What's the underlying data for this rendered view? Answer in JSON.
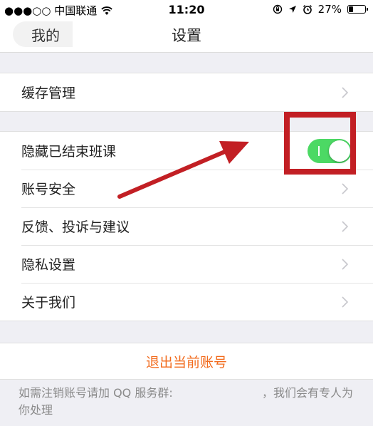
{
  "status_bar": {
    "carrier": "●●●○○ 中国联通",
    "time": "11:20",
    "battery": "27%",
    "battery_level": 0.27
  },
  "nav": {
    "back_label": "我的",
    "title": "设置"
  },
  "groups": [
    {
      "items": [
        {
          "label": "缓存管理",
          "control": "chevron"
        }
      ]
    },
    {
      "items": [
        {
          "label": "隐藏已结束班课",
          "control": "toggle",
          "on": true
        },
        {
          "label": "账号安全",
          "control": "chevron"
        },
        {
          "label": "反馈、投诉与建议",
          "control": "chevron"
        },
        {
          "label": "隐私设置",
          "control": "chevron"
        },
        {
          "label": "关于我们",
          "control": "chevron"
        }
      ]
    }
  ],
  "logout_label": "退出当前账号",
  "footer": {
    "note_left": "如需注销账号请加 QQ 服务群:",
    "note_right": "，我们会有专人为",
    "note_line2": "你处理"
  },
  "colors": {
    "accent": "#f26b1d",
    "toggle_on": "#4cd964",
    "annotation": "#c21f24"
  }
}
